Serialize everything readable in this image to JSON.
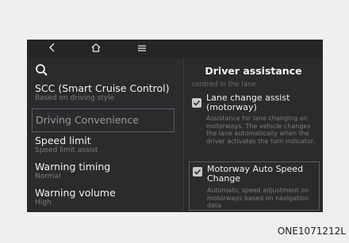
{
  "nav": {
    "back_icon": "chevron-left-icon",
    "home_icon": "home-icon",
    "menu_icon": "menu-icon"
  },
  "left": {
    "search_icon": "search-icon",
    "items": [
      {
        "title": "SCC (Smart Cruise Control)",
        "subtitle": "Based on driving style"
      },
      {
        "title": "Driving Convenience",
        "subtitle": ""
      },
      {
        "title": "Speed limit",
        "subtitle": "Speed limit assist"
      },
      {
        "title": "Warning timing",
        "subtitle": "Normal"
      },
      {
        "title": "Warning volume",
        "subtitle": "High"
      }
    ]
  },
  "right": {
    "title": "Driver assistance",
    "faded_text": "centred in the lane",
    "options": [
      {
        "title": "Lane change assist (motorway)",
        "desc": "Assistance for lane changing on motorways. The vehicle changes the lane automatically when the driver activates the turn indicator.",
        "checked": true
      },
      {
        "title": "Motorway Auto Speed Change",
        "desc": "Automatic speed adjustment on motorways based on navigation data",
        "checked": true
      }
    ]
  },
  "caption": "ONE1071212L",
  "colors": {
    "screen_bg": "#2b2b2d",
    "page_bg": "#efefef",
    "text_primary": "#f0f0f0",
    "text_secondary": "#7d7d80"
  }
}
